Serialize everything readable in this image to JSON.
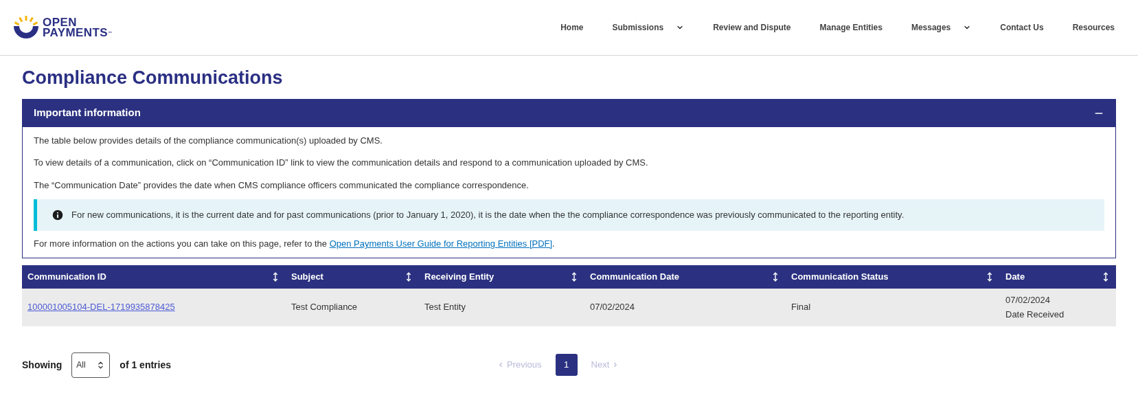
{
  "logo": {
    "line1": "OPEN",
    "line2": "PAYMENTS",
    "mark": "™"
  },
  "nav": [
    {
      "label": "Home",
      "dropdown": false
    },
    {
      "label": "Submissions",
      "dropdown": true
    },
    {
      "label": "Review and Dispute",
      "dropdown": false
    },
    {
      "label": "Manage Entities",
      "dropdown": false
    },
    {
      "label": "Messages",
      "dropdown": true
    },
    {
      "label": "Contact Us",
      "dropdown": false
    },
    {
      "label": "Resources",
      "dropdown": false
    }
  ],
  "page_title": "Compliance Communications",
  "info_panel": {
    "title": "Important information",
    "expanded": true,
    "paragraphs": [
      "The table below provides details of the compliance communication(s) uploaded by CMS.",
      "To view details of a communication, click on “Communication ID” link to view the communication details and respond to a communication uploaded by CMS.",
      "The “Communication Date” provides the date when CMS compliance officers communicated the compliance correspondence."
    ],
    "note": "For new communications, it is the current date and for past communications (prior to January 1, 2020), it is the date when the the compliance correspondence was previously communicated to the reporting entity.",
    "footer_text": "For more information on the actions you can take on this page, refer to the ",
    "footer_link": "Open Payments User Guide for Reporting Entities [PDF]",
    "footer_end": "."
  },
  "table": {
    "columns": [
      "Communication ID",
      "Subject",
      "Receiving Entity",
      "Communication Date",
      "Communication Status",
      "Date"
    ],
    "rows": [
      {
        "communication_id": "100001005104-DEL-1719935878425",
        "subject": "Test Compliance",
        "receiving_entity": "Test Entity",
        "communication_date": "07/02/2024",
        "communication_status": "Final",
        "date": "07/02/2024",
        "date_note": "Date Received"
      }
    ]
  },
  "footer": {
    "showing_label": "Showing",
    "page_size": "All",
    "entries_label": "of 1 entries"
  },
  "pagination": {
    "previous": {
      "label": "Previous",
      "disabled": true
    },
    "pages": [
      {
        "label": "1",
        "selected": true
      }
    ],
    "next": {
      "label": "Next",
      "disabled": true
    }
  }
}
